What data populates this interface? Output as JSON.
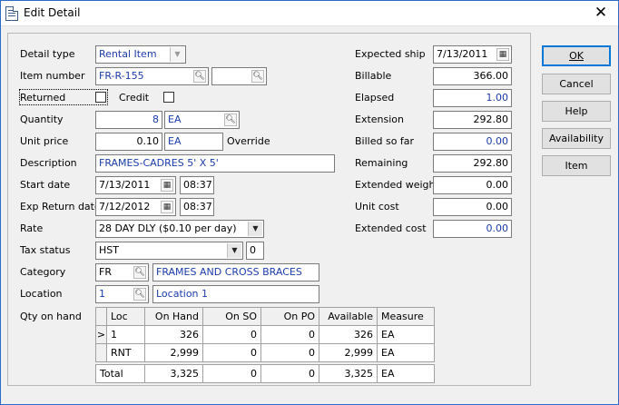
{
  "window": {
    "title": "Edit Detail",
    "close_glyph": "✕"
  },
  "left": {
    "detail_type": {
      "label": "Detail type",
      "value": "Rental Item"
    },
    "item_number": {
      "label": "Item number",
      "value": "FR-R-155",
      "value2": ""
    },
    "returned": {
      "label": "Returned",
      "checked": false
    },
    "credit": {
      "label": "Credit",
      "checked": false
    },
    "quantity": {
      "label": "Quantity",
      "value": "8",
      "unit": "EA"
    },
    "unit_price": {
      "label": "Unit price",
      "value": "0.10",
      "unit": "EA",
      "override_label": "Override"
    },
    "description": {
      "label": "Description",
      "value": "FRAMES-CADRES  5' X 5'"
    },
    "start_date": {
      "label": "Start date",
      "date": "7/13/2011",
      "time": "08:37"
    },
    "exp_return_date": {
      "label": "Exp Return date",
      "date": "7/12/2012",
      "time": "08:37"
    },
    "rate": {
      "label": "Rate",
      "value": "28 DAY DLY ($0.10 per day)"
    },
    "tax_status": {
      "label": "Tax status",
      "value": "HST",
      "extra": "0"
    },
    "category": {
      "label": "Category",
      "code": "FR",
      "name": "FRAMES AND CROSS BRACES"
    },
    "location": {
      "label": "Location",
      "code": "1",
      "name": "Location 1"
    },
    "qty_on_hand": {
      "label": "Qty on hand",
      "columns": [
        "Loc",
        "On Hand",
        "On SO",
        "On PO",
        "Available",
        "Measure"
      ],
      "rows": [
        {
          "marker": ">",
          "loc": "1",
          "on_hand": "326",
          "on_so": "0",
          "on_po": "0",
          "available": "326",
          "measure": "EA"
        },
        {
          "marker": "",
          "loc": "RNT",
          "on_hand": "2,999",
          "on_so": "0",
          "on_po": "0",
          "available": "2,999",
          "measure": "EA"
        }
      ],
      "total": {
        "label": "Total",
        "on_hand": "3,325",
        "on_so": "0",
        "on_po": "0",
        "available": "3,325",
        "measure": "EA"
      }
    }
  },
  "right": {
    "expected_ship": {
      "label": "Expected ship",
      "value": "7/13/2011"
    },
    "billable": {
      "label": "Billable",
      "value": "366.00"
    },
    "elapsed": {
      "label": "Elapsed",
      "value": "1.00"
    },
    "extension": {
      "label": "Extension",
      "value": "292.80"
    },
    "billed_so_far": {
      "label": "Billed so far",
      "value": "0.00"
    },
    "remaining": {
      "label": "Remaining",
      "value": "292.80"
    },
    "extended_weight": {
      "label": "Extended weight",
      "value": "0.00"
    },
    "unit_cost": {
      "label": "Unit cost",
      "value": "0.00"
    },
    "extended_cost": {
      "label": "Extended cost",
      "value": "0.00"
    }
  },
  "buttons": {
    "ok": "OK",
    "cancel": "Cancel",
    "help": "Help",
    "availability": "Availability",
    "item": "Item"
  },
  "colors": {
    "accent": "#0078d7",
    "value_blue": "#1a3caa",
    "window_border": "#2a6cc4"
  }
}
